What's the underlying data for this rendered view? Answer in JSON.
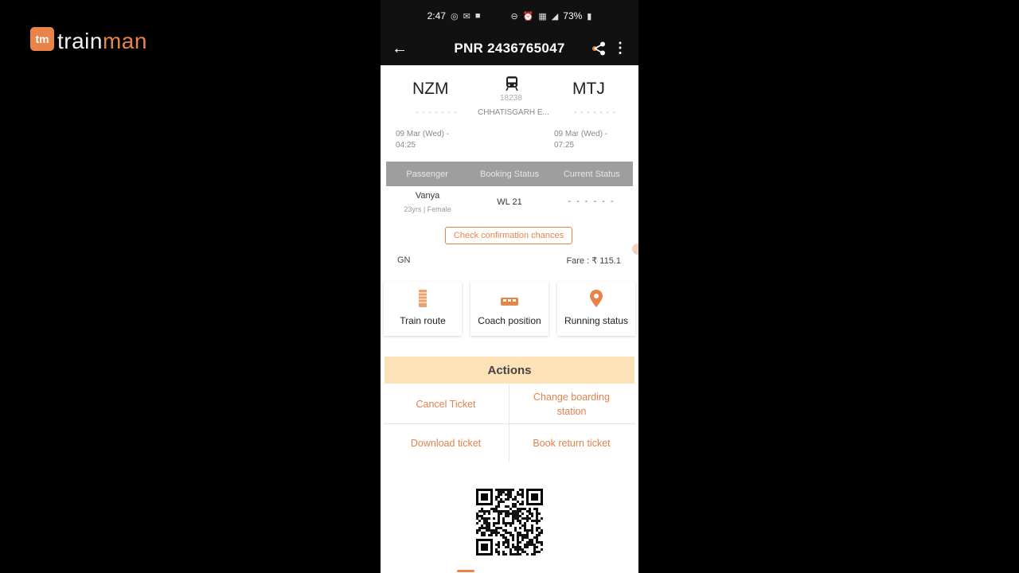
{
  "watermark": {
    "logo_mark": "tm",
    "name_part1": "train",
    "name_part2": "man"
  },
  "status_bar": {
    "time": "2:47",
    "battery": "73%"
  },
  "app_bar": {
    "title": "PNR 2436765047"
  },
  "journey": {
    "from_code": "NZM",
    "to_code": "MTJ",
    "from_dashes": "- - - - - - -",
    "to_dashes": "- - - - - - -",
    "train_number": "18238",
    "train_name": "CHHATISGARH E...",
    "from_datetime_line1": "09 Mar (Wed) -",
    "from_datetime_line2": "04:25",
    "to_datetime_line1": "09 Mar (Wed) -",
    "to_datetime_line2": "07:25"
  },
  "passenger_table": {
    "headers": [
      "Passenger",
      "Booking Status",
      "Current Status"
    ],
    "rows": [
      {
        "name": "Vanya",
        "meta": "23yrs | Female",
        "booking_status": "WL 21",
        "current_status": "- - - - - -"
      }
    ]
  },
  "check_chances_label": "Check confirmation chances",
  "quota": "GN",
  "fare": "Fare : ₹ 115.1",
  "tiles": [
    {
      "label": "Train route",
      "icon": "train-route-icon"
    },
    {
      "label": "Coach position",
      "icon": "coach-icon"
    },
    {
      "label": "Running status",
      "icon": "location-pin-icon"
    }
  ],
  "actions": {
    "title": "Actions",
    "cancel": "Cancel Ticket",
    "change_boarding_line1": "Change boarding",
    "change_boarding_line2": "station",
    "download": "Download ticket",
    "book_return": "Book return ticket"
  },
  "colors": {
    "accent": "#e8834a",
    "actions_bg": "#fde2b8",
    "header_bg": "#111111",
    "table_header": "#9e9e9e"
  }
}
